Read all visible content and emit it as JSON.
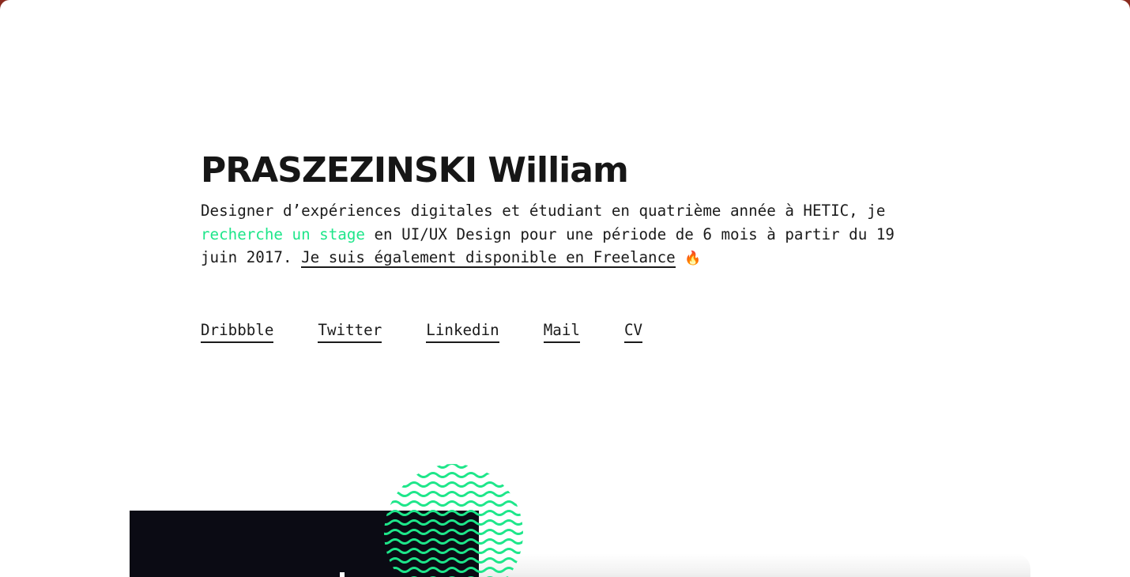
{
  "hero": {
    "name": "PRASZEZINSKI William",
    "intro_part1": "Designer d’expériences digitales et étudiant en quatrième année à HETIC, je ",
    "intro_link_internship": "recherche un stage",
    "intro_part2": " en UI/UX Design pour une période de 6 mois à partir du 19 juin 2017. ",
    "intro_link_freelance": "Je suis également disponible en Freelance",
    "intro_emoji": "🔥"
  },
  "social_links": [
    {
      "label": "Dribbble"
    },
    {
      "label": "Twitter"
    },
    {
      "label": "Linkedin"
    },
    {
      "label": "Mail"
    },
    {
      "label": "CV"
    }
  ],
  "colors": {
    "accent": "#1ee68a",
    "text": "#1b1b1b",
    "heading": "#161616",
    "dark_card": "#0b0b14",
    "background": "#ffffff"
  },
  "icons": {
    "intro_emoji": "fire-icon",
    "decoration": "wave-circle-graphic"
  }
}
